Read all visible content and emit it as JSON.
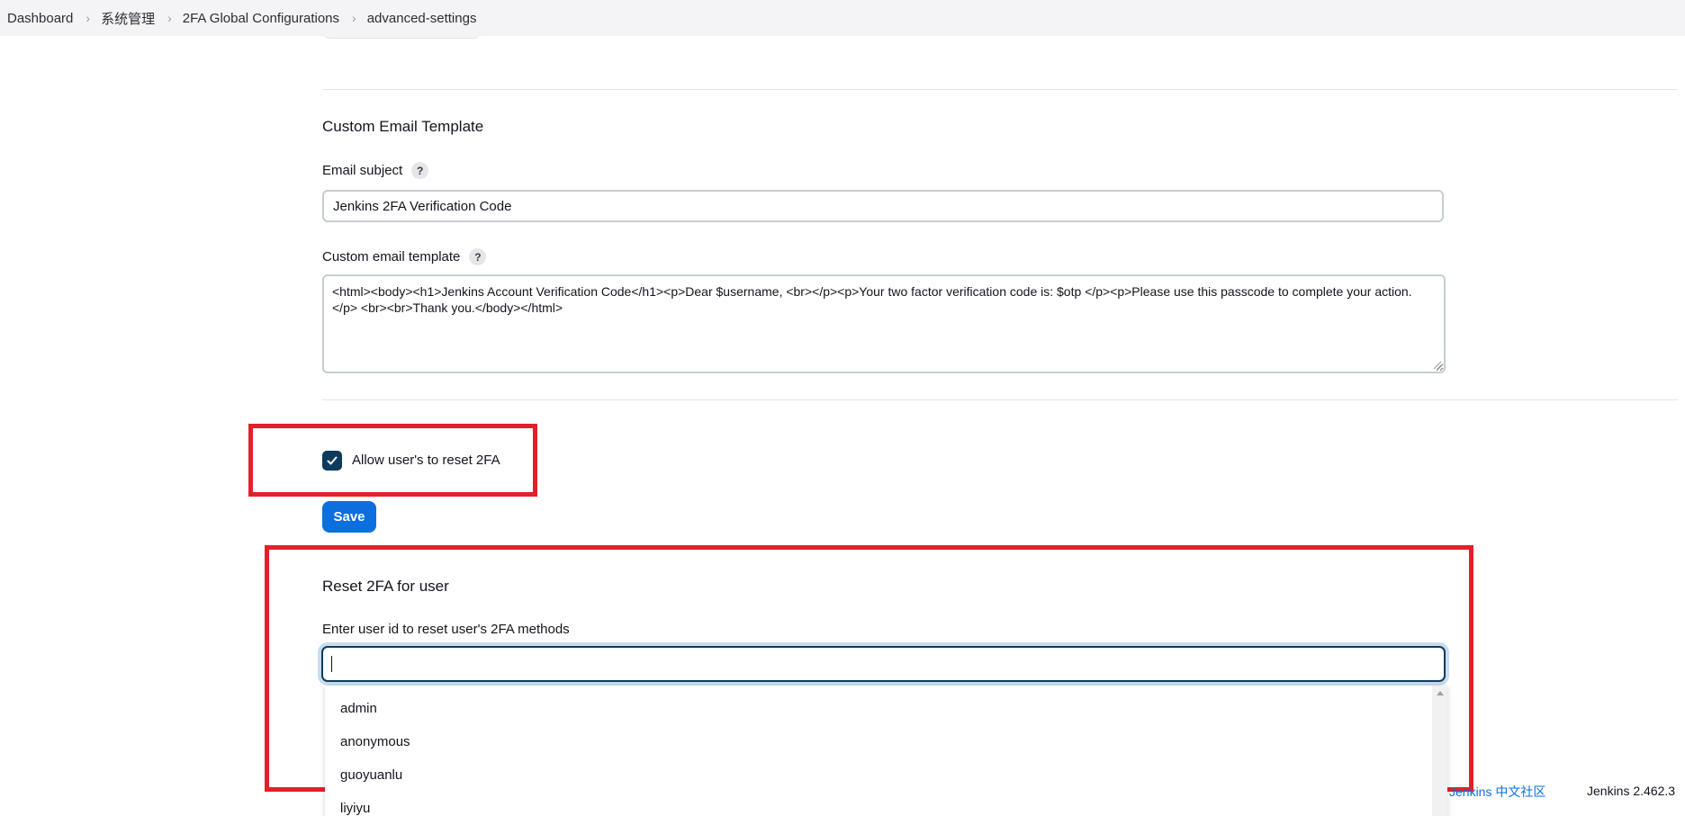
{
  "breadcrumb": {
    "items": [
      "Dashboard",
      "系统管理",
      "2FA Global Configurations",
      "advanced-settings"
    ]
  },
  "email_template_section": {
    "title": "Custom Email Template",
    "subject_label": "Email subject",
    "subject_value": "Jenkins 2FA Verification Code",
    "template_label": "Custom email template",
    "template_value": "<html><body><h1>Jenkins Account Verification Code</h1><p>Dear $username, <br></p><p>Your two factor verification code is: $otp </p><p>Please use this passcode to complete your action.</p> <br><br>Thank you.</body></html>",
    "help_glyph": "?"
  },
  "allow_reset": {
    "label": "Allow user's to reset 2FA",
    "checked": true
  },
  "save_button": {
    "label": "Save",
    "color": "#0b6fde"
  },
  "reset_section": {
    "title": "Reset 2FA for user",
    "input_label": "Enter user id to reset user's 2FA methods",
    "input_value": "",
    "suggestions": [
      "admin",
      "anonymous",
      "guoyuanlu",
      "liyiyu"
    ]
  },
  "footer": {
    "community_link": "Jenkins 中文社区",
    "version": "Jenkins 2.462.3"
  },
  "colors": {
    "highlight_box": "#e3202a",
    "checkbox_fill": "#0e3a5c",
    "link": "#0b6fde"
  },
  "icons": [
    "chevron-right-icon",
    "help-icon",
    "checkmark-icon",
    "scroll-up-arrow-icon"
  ]
}
